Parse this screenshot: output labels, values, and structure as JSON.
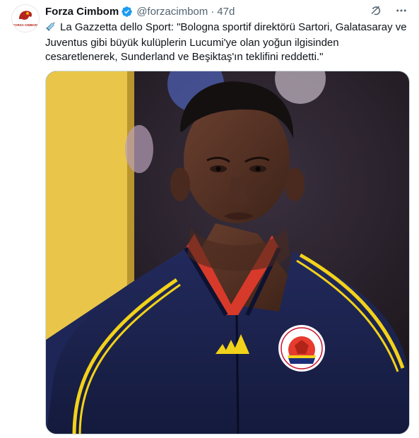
{
  "account": {
    "name": "Forza Cimbom",
    "handle": "@forzacimbom",
    "separator": "·",
    "time": "47d",
    "avatar_text": "FORZA CIMBOM"
  },
  "tweet": {
    "emoji": "syringe-emoji",
    "text": "La Gazzetta dello Sport: \"Bologna sportif direktörü Sartori, Galatasaray ve Juventus gibi büyük kulüplerin Lucumi'ye olan yoğun ilgisinden cesaretlenerek, Sunderland ve Beşiktaş'ın teklifini reddetti.\""
  },
  "icons": {
    "verified": "verified-badge-icon",
    "grok": "grok-icon",
    "more": "more-icon"
  },
  "colors": {
    "verified": "#1d9bf0",
    "text": "#0f1419",
    "secondary": "#536471",
    "jacket": "#1c2350",
    "stripe": "#f2d21a"
  }
}
